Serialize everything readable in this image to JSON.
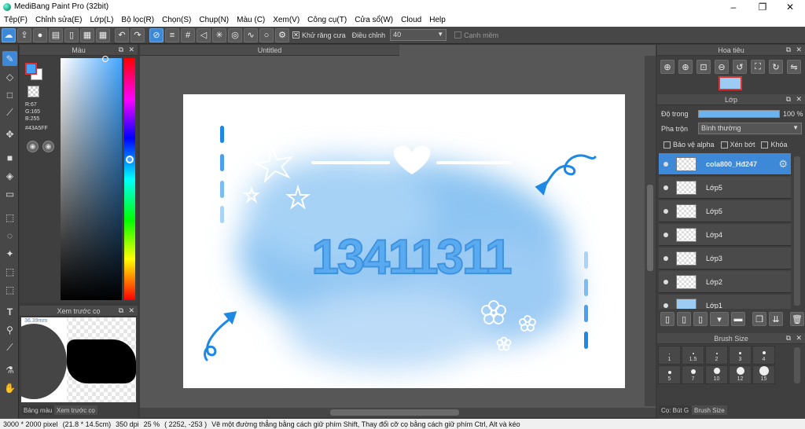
{
  "window": {
    "title": "MediBang Paint Pro (32bit)",
    "minimize": "–",
    "restore": "❐",
    "close": "✕"
  },
  "menu": [
    "Tệp(F)",
    "Chỉnh sửa(E)",
    "Lớp(L)",
    "Bộ lọc(R)",
    "Chọn(S)",
    "Chụp(N)",
    "Màu (C)",
    "Xem(V)",
    "Công cụ(T)",
    "Cửa sổ(W)",
    "Cloud",
    "Help"
  ],
  "toolbar": {
    "antialias_label": "Khử răng cưa",
    "adjust_label": "Điều chỉnh",
    "adjust_value": "40",
    "edge_label": "Cạnh mềm",
    "antialias_checked": "✕"
  },
  "color_panel": {
    "title": "Màu",
    "r": "R:67",
    "g": "G:165",
    "b": "B:255",
    "hex": "#43A5FF",
    "fg_color": "#43a5ff"
  },
  "brush_preview": {
    "title": "Xem trước cọ",
    "size": "36.39mm"
  },
  "bottom_tabs": {
    "palette": "Bảng màu",
    "preview": "Xem trước cọ"
  },
  "document": {
    "tab": "Untitled"
  },
  "artwork": {
    "number": "13411311"
  },
  "navigator": {
    "title": "Hoa tiêu"
  },
  "layers": {
    "title": "Lớp",
    "opacity_label": "Độ trong",
    "opacity_value": "100 %",
    "blend_label": "Pha trộn",
    "blend_value": "Bình thường",
    "protect_alpha": "Bảo vệ alpha",
    "clipping": "Xén bớt",
    "lock": "Khóa",
    "items": [
      {
        "name": "cola800_Hđ247"
      },
      {
        "name": "Lớp5"
      },
      {
        "name": "Lớp5"
      },
      {
        "name": "Lớp4"
      },
      {
        "name": "Lớp3"
      },
      {
        "name": "Lớp2"
      },
      {
        "name": "Lớp1"
      }
    ]
  },
  "brush_size": {
    "title": "Brush Size",
    "row1": [
      "1",
      "1.5",
      "2",
      "3",
      "4"
    ],
    "row2": [
      "5",
      "7",
      "10",
      "12",
      "15"
    ],
    "tab_brush": "Cọ: Bút G",
    "tab_size": "Brush Size"
  },
  "status": {
    "size": "3000 * 2000 pixel",
    "cm": "(21.8 * 14.5cm)",
    "dpi": "350 dpi",
    "zoom": "25 %",
    "coords": "( 2252, -253 )",
    "hint": "Vẽ một đường thẳng bằng cách giữ phím Shift, Thay đổi cỡ cọ bằng cách giữ phím Ctrl, Alt và kéo"
  }
}
